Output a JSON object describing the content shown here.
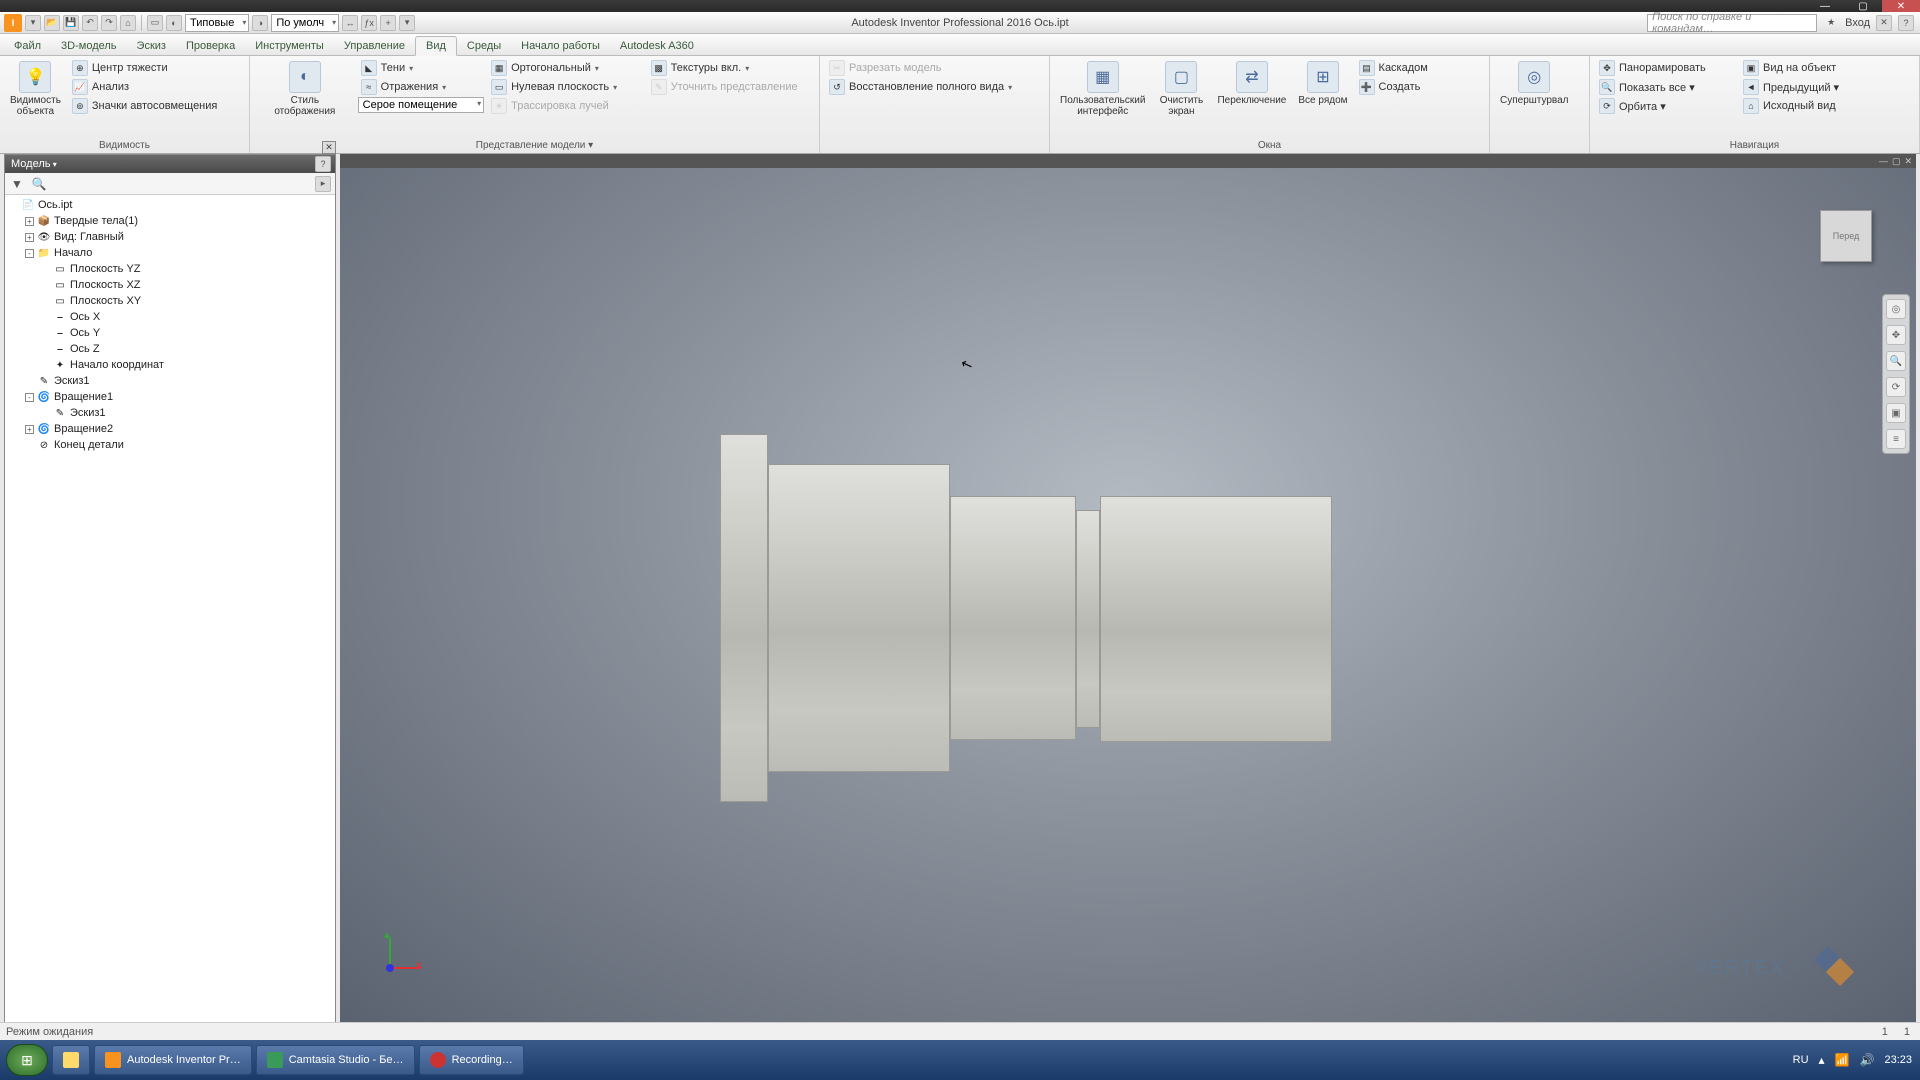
{
  "app": {
    "title": "Autodesk Inventor Professional 2016   Ось.ipt",
    "search_placeholder": "Поиск по справке и командам…",
    "login": "Вход"
  },
  "qat_combo1": "Типовые",
  "qat_combo2": "По умолч",
  "menu": {
    "tabs": [
      "Файл",
      "3D-модель",
      "Эскиз",
      "Проверка",
      "Инструменты",
      "Управление",
      "Вид",
      "Среды",
      "Начало работы",
      "Autodesk A360"
    ],
    "active": 6
  },
  "ribbon": {
    "p0": {
      "label": "Видимость",
      "big": "Видимость\nобъекта",
      "i": [
        "Центр тяжести",
        "Анализ",
        "Значки автосовмещения"
      ]
    },
    "p1": {
      "label": "",
      "big": "Стиль отображения",
      "r": [
        {
          "t": "Тени",
          "dd": true
        },
        {
          "t": "Отражения",
          "dd": true
        },
        {
          "combo": "Серое помещение"
        }
      ],
      "r2": [
        {
          "t": "Ортогональный",
          "dd": true
        },
        {
          "t": "Нулевая плоскость",
          "dd": true
        },
        {
          "t": "Трассировка лучей",
          "dis": true
        }
      ],
      "r3": [
        {
          "t": "Текстуры вкл.",
          "dd": true
        },
        {
          "t": "Уточнить представление",
          "dis": true
        }
      ],
      "footer": "Представление модели ▾"
    },
    "p2": {
      "i": [
        {
          "t": "Разрезать модель",
          "dis": true
        },
        {
          "t": "Восстановление полного вида",
          "dd": true
        }
      ]
    },
    "p3": {
      "label": "Окна",
      "bigs": [
        "Пользовательский\nинтерфейс",
        "Очистить\nэкран",
        "Переключение",
        "Все рядом"
      ],
      "s": [
        "Каскадом",
        "Создать"
      ]
    },
    "p4": {
      "big": "Суперштурвал"
    },
    "p5": {
      "label": "Навигация",
      "c1": [
        "Панорамировать",
        "Показать все ▾",
        "Орбита ▾"
      ],
      "c2": [
        "Вид на объект",
        "Предыдущий ▾",
        "Исходный вид"
      ]
    }
  },
  "browser": {
    "title": "Модель",
    "tree": [
      {
        "d": 0,
        "exp": "",
        "ico": "📄",
        "t": "Ось.ipt"
      },
      {
        "d": 1,
        "exp": "+",
        "ico": "📦",
        "t": "Твердые тела(1)"
      },
      {
        "d": 1,
        "exp": "+",
        "ico": "👁",
        "t": "Вид: Главный"
      },
      {
        "d": 1,
        "exp": "-",
        "ico": "📁",
        "t": "Начало"
      },
      {
        "d": 2,
        "exp": "",
        "ico": "▭",
        "t": "Плоскость YZ"
      },
      {
        "d": 2,
        "exp": "",
        "ico": "▭",
        "t": "Плоскость XZ"
      },
      {
        "d": 2,
        "exp": "",
        "ico": "▭",
        "t": "Плоскость XY"
      },
      {
        "d": 2,
        "exp": "",
        "ico": "⎯",
        "t": "Ось X"
      },
      {
        "d": 2,
        "exp": "",
        "ico": "⎯",
        "t": "Ось Y"
      },
      {
        "d": 2,
        "exp": "",
        "ico": "⎯",
        "t": "Ось Z"
      },
      {
        "d": 2,
        "exp": "",
        "ico": "✦",
        "t": "Начало координат"
      },
      {
        "d": 1,
        "exp": "",
        "ico": "✎",
        "t": "Эскиз1"
      },
      {
        "d": 1,
        "exp": "-",
        "ico": "🌀",
        "t": "Вращение1"
      },
      {
        "d": 2,
        "exp": "",
        "ico": "✎",
        "t": "Эскиз1"
      },
      {
        "d": 1,
        "exp": "+",
        "ico": "🌀",
        "t": "Вращение2"
      },
      {
        "d": 1,
        "exp": "",
        "ico": "⊘",
        "t": "Конец детали"
      }
    ]
  },
  "viewcube": "Перед",
  "watermark": "VERTEX",
  "status": {
    "text": "Режим ожидания",
    "n1": "1",
    "n2": "1"
  },
  "taskbar": {
    "items": [
      "Autodesk Inventor Pr…",
      "Camtasia Studio - Бе…",
      "Recording…"
    ],
    "lang": "RU",
    "time": "23:23"
  }
}
